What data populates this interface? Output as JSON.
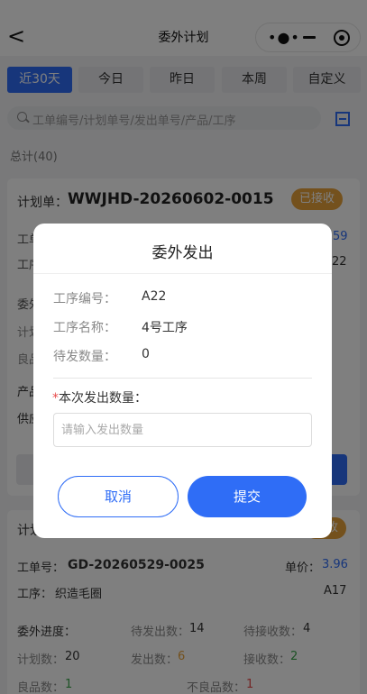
{
  "nav": {
    "title": "委外计划",
    "back": "<"
  },
  "tabs": [
    "近30天",
    "今日",
    "昨日",
    "本周",
    "自定义"
  ],
  "search": {
    "placeholder": "工单编号/计划单号/发出单号/产品/工序"
  },
  "total": "总计(40)",
  "card1": {
    "plan_label": "计划单：",
    "plan_no": "WWJHD-20260602-0015",
    "status": "已接收",
    "row1_left": "工单",
    "row1_right": "59",
    "row2_left": "工序",
    "row2_right": "22",
    "row3_left": "委外",
    "row4_left": "计划",
    "row5_left": "良品",
    "row6_left": "产品",
    "row7_left": "供应"
  },
  "card2": {
    "plan_label": "计划",
    "status": "收",
    "wo_label": "工单号：",
    "wo_value": "GD-20260529-0025",
    "price_label": "单价：",
    "price_value": "3.96",
    "process_label": "工序：",
    "process_value": "织造毛圈",
    "process_code": "A17",
    "progress_label": "委外进度：",
    "pending_send_label": "待发出数：",
    "pending_send_value": "14",
    "pending_recv_label": "待接收数：",
    "pending_recv_value": "4",
    "plan_qty_label": "计划数：",
    "plan_qty_value": "20",
    "sent_label": "发出数：",
    "sent_value": "6",
    "recv_label": "接收数：",
    "recv_value": "2",
    "good_label": "良品数：",
    "good_value": "1",
    "bad_label": "不良品数：",
    "bad_value": "1"
  },
  "modal": {
    "title": "委外发出",
    "process_code_label": "工序编号：",
    "process_code_value": "A22",
    "process_name_label": "工序名称：",
    "process_name_value": "4号工序",
    "pending_label": "待发数量：",
    "pending_value": "0",
    "required_star": "*",
    "qty_label": "本次发出数量：",
    "qty_placeholder": "请输入发出数量",
    "cancel": "取消",
    "submit": "提交"
  },
  "colors": {
    "accent": "#2f6df6",
    "status": "#e8a23b",
    "green": "#3aa54b",
    "red": "#e84b4b"
  },
  "icons": [
    "back-arrow-icon",
    "more-dots-icon",
    "minimize-icon",
    "close-circle-icon",
    "search-icon",
    "scan-icon"
  ]
}
